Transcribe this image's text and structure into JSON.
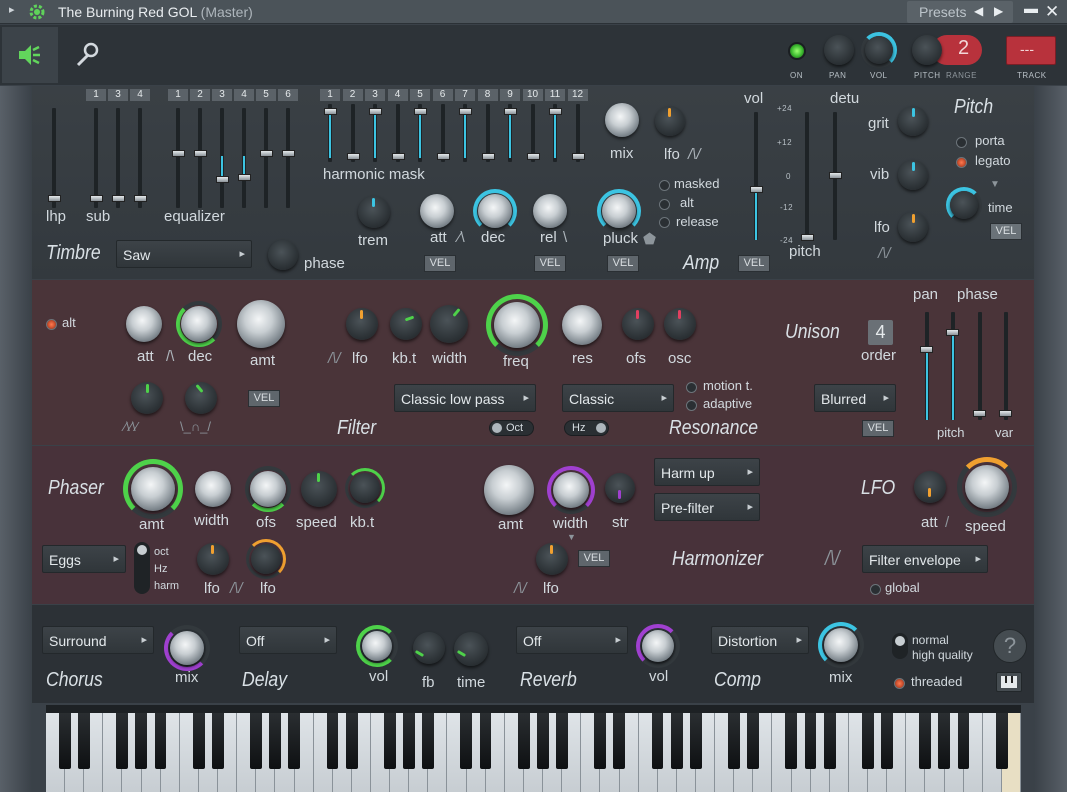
{
  "window": {
    "title": "The Burning Red GOL",
    "subtitle": "(Master)",
    "presets_label": "Presets"
  },
  "top": {
    "on": "ON",
    "pan": "PAN",
    "vol": "VOL",
    "pitch": "PITCH",
    "range": "RANGE",
    "range_value": "2",
    "track": "TRACK",
    "track_value": "---"
  },
  "timbre": {
    "title": "Timbre",
    "sub_numbers": [
      "1",
      "3",
      "4"
    ],
    "eq_numbers": [
      "1",
      "2",
      "3",
      "4",
      "5",
      "6"
    ],
    "harm_numbers": [
      "1",
      "2",
      "3",
      "4",
      "5",
      "6",
      "7",
      "8",
      "9",
      "10",
      "11",
      "12"
    ],
    "lhp": "lhp",
    "sub": "sub",
    "equalizer": "equalizer",
    "harmonic_mask": "harmonic mask",
    "waveform": "Saw",
    "phase": "phase",
    "trem": "trem"
  },
  "amp": {
    "title": "Amp",
    "mix": "mix",
    "lfo": "lfo",
    "att": "att",
    "dec": "dec",
    "rel": "rel",
    "pluck": "pluck",
    "vel": "VEL",
    "masked": "masked",
    "alt": "alt",
    "release": "release",
    "vol": "vol",
    "detu": "detu",
    "pitch": "pitch",
    "scale": [
      "+24",
      "+12",
      "0",
      "-12",
      "-24"
    ]
  },
  "pitch": {
    "title": "Pitch",
    "grit": "grit",
    "vib": "vib",
    "lfo": "lfo",
    "porta": "porta",
    "legato": "legato",
    "time": "time",
    "vel": "VEL"
  },
  "filter": {
    "title": "Filter",
    "alt": "alt",
    "att": "att",
    "dec": "dec",
    "amt": "amt",
    "lfo": "lfo",
    "kbt": "kb.t",
    "width": "width",
    "freq": "freq",
    "res": "res",
    "ofs": "ofs",
    "osc": "osc",
    "vel": "VEL",
    "type": "Classic low pass",
    "oct": "Oct"
  },
  "resonance": {
    "title": "Resonance",
    "type": "Classic",
    "motion": "motion t.",
    "adaptive": "adaptive",
    "hz": "Hz"
  },
  "unison": {
    "title": "Unison",
    "order_label": "order",
    "order_value": "4",
    "type": "Blurred",
    "vel": "VEL",
    "pan": "pan",
    "phase": "phase",
    "pitch": "pitch",
    "var": "var"
  },
  "phaser": {
    "title": "Phaser",
    "amt": "amt",
    "width": "width",
    "ofs": "ofs",
    "speed": "speed",
    "kbt": "kb.t",
    "preset": "Eggs",
    "oct": "oct",
    "hz": "Hz",
    "harm": "harm",
    "lfo1": "lfo",
    "lfo2": "lfo"
  },
  "harmonizer": {
    "title": "Harmonizer",
    "amt": "amt",
    "width": "width",
    "str": "str",
    "mode": "Harm up",
    "position": "Pre-filter",
    "lfo": "lfo",
    "vel": "VEL"
  },
  "lfo": {
    "title": "LFO",
    "att": "att",
    "speed": "speed",
    "target": "Filter envelope",
    "global": "global"
  },
  "fx": {
    "chorus": {
      "title": "Chorus",
      "type": "Surround",
      "mix": "mix"
    },
    "delay": {
      "title": "Delay",
      "type": "Off",
      "vol": "vol",
      "fb": "fb",
      "time": "time"
    },
    "reverb": {
      "title": "Reverb",
      "type": "Off",
      "vol": "vol"
    },
    "comp": {
      "title": "Comp",
      "type": "Distortion",
      "mix": "mix"
    },
    "normal": "normal",
    "high_quality": "high quality",
    "threaded": "threaded",
    "help": "?"
  },
  "colors": {
    "accent_cyan": "#3cc4e2",
    "accent_green": "#4ed24a",
    "accent_orange": "#f0a030",
    "accent_purple": "#a040d0",
    "accent_red": "#e04050",
    "filter_panel": "#4a3439"
  }
}
